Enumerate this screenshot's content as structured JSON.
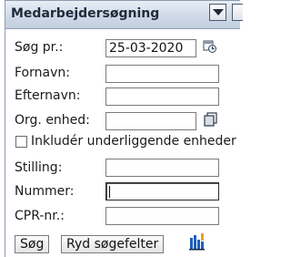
{
  "panel": {
    "title": "Medarbejdersøgning",
    "menu_icon": "dropdown-arrow-icon"
  },
  "form": {
    "search_date": {
      "label": "Søg pr.:",
      "value": "25-03-2020",
      "icon": "calendar-icon"
    },
    "first_name": {
      "label": "Fornavn:",
      "value": ""
    },
    "last_name": {
      "label": "Efternavn:",
      "value": ""
    },
    "org_unit": {
      "label": "Org. enhed:",
      "value": "",
      "icon": "copy-select-icon"
    },
    "include_sub_units": {
      "label": "Inkludér underliggende enheder",
      "checked": false
    },
    "position": {
      "label": "Stilling:",
      "value": ""
    },
    "number": {
      "label": "Nummer:",
      "value": ""
    },
    "cpr": {
      "label": "CPR-nr.:",
      "value": ""
    }
  },
  "actions": {
    "search_label": "Søg",
    "clear_label": "Ryd søgefelter",
    "org_chart_icon": "org-chart-icon"
  },
  "colors": {
    "header_gradient_top": "#e9eef5",
    "header_gradient_bottom": "#c2cfe0",
    "border": "#8c9cb0",
    "org_icon_blue": "#1f5fbf"
  }
}
